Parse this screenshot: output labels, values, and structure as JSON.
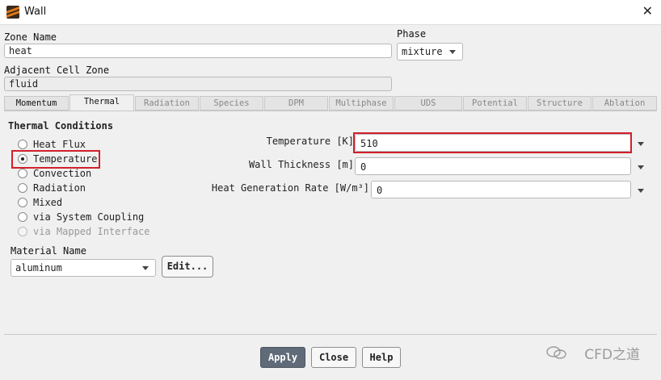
{
  "window": {
    "title": "Wall",
    "icon": "fluent-app-icon",
    "close_icon": "close-icon"
  },
  "zone": {
    "label": "Zone Name",
    "value": "heat"
  },
  "phase": {
    "label": "Phase",
    "value": "mixture"
  },
  "adjacent": {
    "label": "Adjacent Cell Zone",
    "value": "fluid"
  },
  "tabs": [
    {
      "label": "Momentum"
    },
    {
      "label": "Thermal"
    },
    {
      "label": "Radiation"
    },
    {
      "label": "Species"
    },
    {
      "label": "DPM"
    },
    {
      "label": "Multiphase"
    },
    {
      "label": "UDS"
    },
    {
      "label": "Potential"
    },
    {
      "label": "Structure"
    },
    {
      "label": "Ablation"
    }
  ],
  "thermal": {
    "title": "Thermal Conditions",
    "options": [
      {
        "label": "Heat Flux"
      },
      {
        "label": "Temperature"
      },
      {
        "label": "Convection"
      },
      {
        "label": "Radiation"
      },
      {
        "label": "Mixed"
      },
      {
        "label": "via System Coupling"
      },
      {
        "label": "via Mapped Interface"
      }
    ],
    "selected": "Temperature"
  },
  "material": {
    "label": "Material Name",
    "value": "aluminum",
    "edit_label": "Edit..."
  },
  "properties": [
    {
      "label": "Temperature [K]",
      "value": "510"
    },
    {
      "label": "Wall Thickness [m]",
      "value": "0"
    },
    {
      "label": "Heat Generation Rate [W/m³]",
      "value": "0"
    }
  ],
  "buttons": {
    "apply": "Apply",
    "close": "Close",
    "help": "Help"
  },
  "watermark": "CFD之道",
  "colors": {
    "highlight": "#d21f2b",
    "primary_button": "#5f6b78"
  }
}
